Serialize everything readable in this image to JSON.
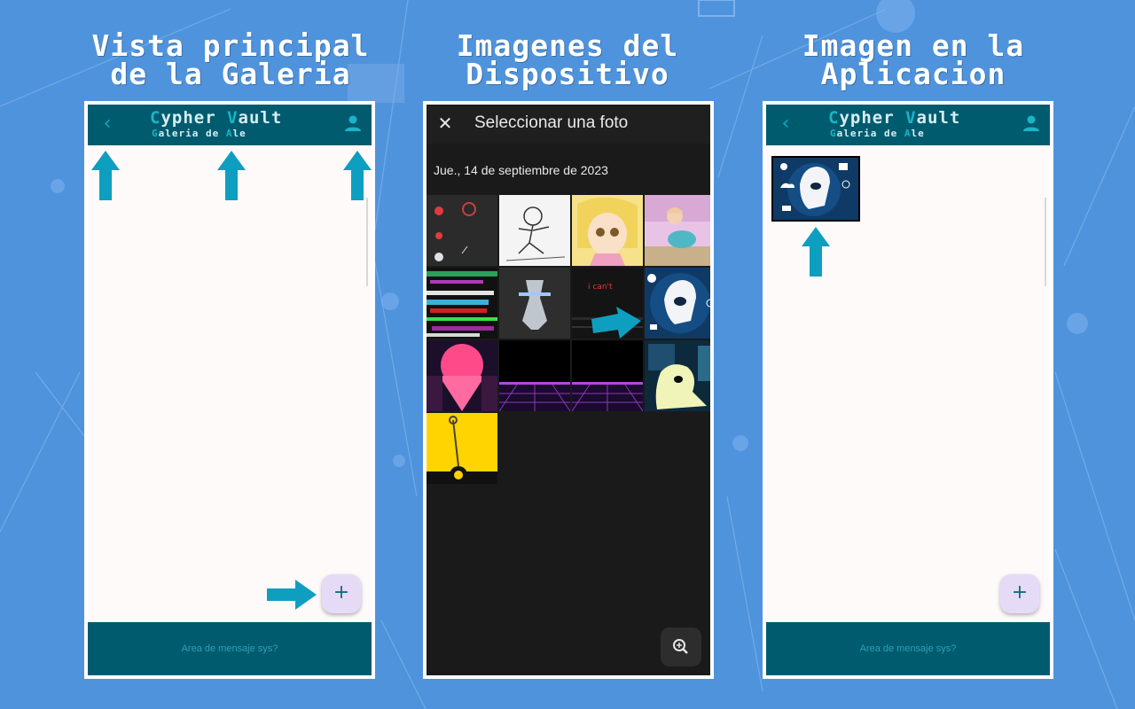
{
  "panels": {
    "left": {
      "heading": [
        "Vista principal",
        "de la Galeria"
      ],
      "app_title": {
        "c1": "C",
        "r1": "ypher ",
        "c2": "V",
        "r2": "ault"
      },
      "app_subtitle": {
        "c1": "G",
        "r1": "aleria de ",
        "c2": "A",
        "r2": "le"
      },
      "fab_label": "+",
      "footer_text": "Area de mensaje sys?"
    },
    "middle": {
      "heading": [
        "Imagenes del",
        "Dispositivo"
      ],
      "picker_title": "Seleccionar una foto",
      "date_label": "Jue., 14 de septiembre de 2023",
      "thumb_text": "i can't"
    },
    "right": {
      "heading": [
        "Imagen en la",
        "Aplicacion"
      ],
      "app_title": {
        "c1": "C",
        "r1": "ypher ",
        "c2": "V",
        "r2": "ault"
      },
      "app_subtitle": {
        "c1": "G",
        "r1": "aleria de ",
        "c2": "A",
        "r2": "le"
      },
      "fab_label": "+",
      "footer_text": "Area de mensaje sys?"
    }
  },
  "colors": {
    "background": "#4f93dc",
    "app_header": "#005b6e",
    "accent": "#1ab4c8",
    "arrow": "#0e9fc0",
    "fab": "#e6dbf7"
  },
  "icons": [
    "back-icon",
    "user-icon",
    "add-icon",
    "close-icon",
    "zoom-icon",
    "arrow-up-icon",
    "arrow-right-icon"
  ]
}
